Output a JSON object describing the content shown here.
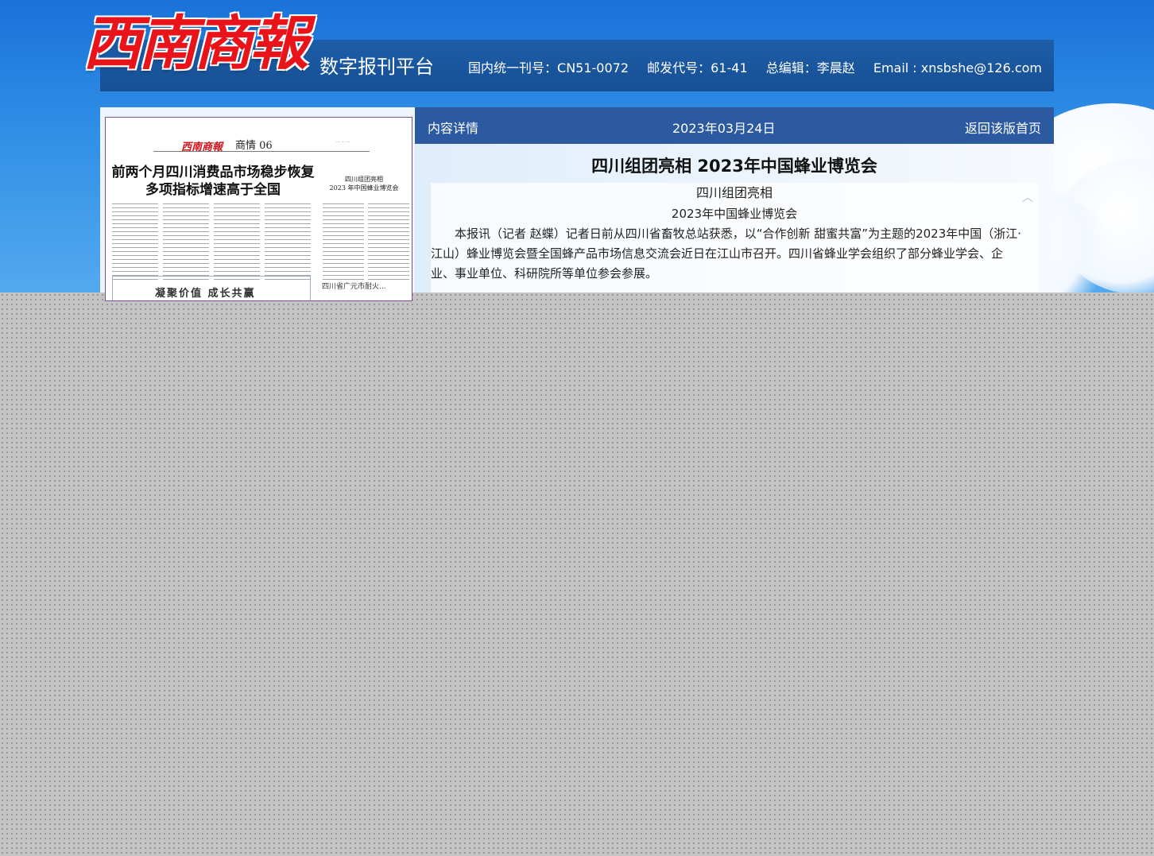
{
  "header": {
    "logo_text": "西南商報",
    "platform_name": "数字报刊平台",
    "issn": "国内统一刊号：CN51-0072",
    "postal_code": "邮发代号：61-41",
    "chief_editor": "总编辑：李晨赵",
    "email": "Email : xnsbshe@126.com"
  },
  "detail_bar": {
    "left_label": "内容详情",
    "date": "2023年03月24日",
    "back_link": "返回该版首页"
  },
  "article": {
    "title": "四川组团亮相 2023年中国蜂业博览会",
    "subtitle1": "四川组团亮相",
    "subtitle2": "2023年中国蜂业博览会",
    "paragraph": "本报讯（记者  赵蝶）记者日前从四川省畜牧总站获悉，以“合作创新 甜蜜共富”为主题的2023年中国（浙江·江山）蜂业博览会暨全国蜂产品市场信息交流会近日在江山市召开。四川省蜂业学会组织了部分蜂业学会、企业、事业单位、科研院所等单位参会参展。"
  },
  "newspaper_thumb": {
    "logo": "西南商報",
    "section": "商情 06",
    "headline": "前两个月四川消费品市场稳步恢复\n多项指标增速高于全国",
    "side_headline": "四川组团亮相\n2023 年中国蜂业博览会",
    "box_text": "凝聚价值 成长共赢",
    "small_text": "四川省广元市耐火..."
  }
}
